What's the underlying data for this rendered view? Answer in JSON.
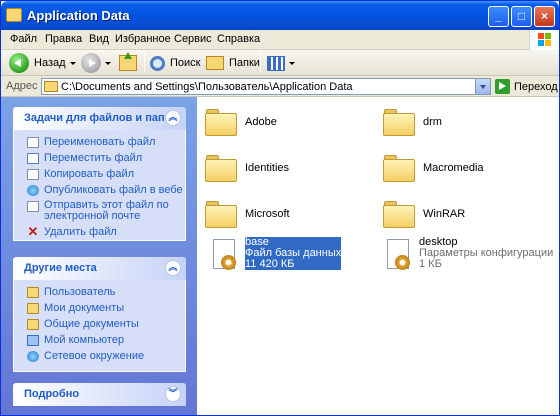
{
  "window": {
    "title": "Application Data",
    "minimize": "_",
    "maximize": "□",
    "close": "×"
  },
  "menu": [
    "Файл",
    "Правка",
    "Вид",
    "Избранное",
    "Сервис",
    "Справка"
  ],
  "toolbar": {
    "back": "Назад",
    "search": "Поиск",
    "folders": "Папки"
  },
  "address": {
    "label": "Адрес",
    "value": "C:\\Documents and Settings\\Пользователь\\Application Data",
    "go": "Переход"
  },
  "tasks": {
    "title": "Задачи для файлов и папок",
    "items": [
      {
        "label": "Переименовать файл",
        "icon": "rename-icon"
      },
      {
        "label": "Переместить файл",
        "icon": "move-icon"
      },
      {
        "label": "Копировать файл",
        "icon": "copy-icon"
      },
      {
        "label": "Опубликовать файл в вебе",
        "icon": "globe-icon"
      },
      {
        "label": "Отправить этот файл по",
        "label2": "электронной почте",
        "icon": "email-icon"
      },
      {
        "label": "Удалить файл",
        "icon": "delete-icon"
      }
    ]
  },
  "places": {
    "title": "Другие места",
    "items": [
      {
        "label": "Пользователь",
        "icon": "folder-icon"
      },
      {
        "label": "Мои документы",
        "icon": "folder-icon"
      },
      {
        "label": "Общие документы",
        "icon": "folder-icon"
      },
      {
        "label": "Мой компьютер",
        "icon": "computer-icon"
      },
      {
        "label": "Сетевое окружение",
        "icon": "network-icon"
      }
    ]
  },
  "details": {
    "title": "Подробно"
  },
  "files": {
    "folders": [
      "Adobe",
      "drm",
      "Identities",
      "Macromedia",
      "Microsoft",
      "WinRAR"
    ],
    "base": {
      "name": "base",
      "type": "Файл базы данных",
      "size": "11 420 КБ"
    },
    "desktop": {
      "name": "desktop",
      "type": "Параметры конфигурации",
      "size": "1 КБ"
    }
  },
  "colors": {
    "titlebar": "#0054e3",
    "sidebar": "#6375d6",
    "link": "#215dc6",
    "selection": "#316ac5"
  }
}
